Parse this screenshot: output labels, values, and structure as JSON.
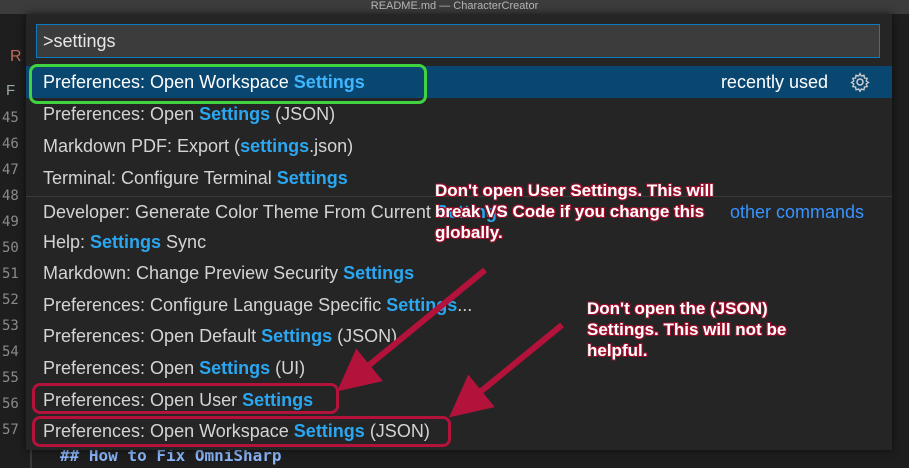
{
  "window": {
    "title": "README.md — CharacterCreator"
  },
  "editor": {
    "tab_fragments": [
      "R",
      "F"
    ],
    "line_numbers": [
      "45",
      "46",
      "47",
      "48",
      "49",
      "50",
      "51",
      "52",
      "53",
      "54",
      "55",
      "56",
      "57"
    ],
    "bottom_text": "## How to Fix OmniSharp"
  },
  "palette": {
    "query": ">settings",
    "items": [
      {
        "pre": "Preferences: Open Workspace ",
        "hl": "Settings",
        "post": "",
        "right": "recently used"
      },
      {
        "pre": "Preferences: Open ",
        "hl": "Settings",
        "post": " (JSON)",
        "right": ""
      },
      {
        "pre": "Markdown PDF: Export (",
        "hl": "settings",
        "post": ".json)",
        "right": ""
      },
      {
        "pre": "Terminal: Configure Terminal ",
        "hl": "Settings",
        "post": "",
        "right": ""
      },
      {
        "pre": "Developer: Generate Color Theme From Current ",
        "hl": "Settings",
        "post": "",
        "right": "other commands"
      },
      {
        "pre": "Help: ",
        "hl": "Settings",
        "post": " Sync",
        "right": ""
      },
      {
        "pre": "Markdown: Change Preview Security ",
        "hl": "Settings",
        "post": "",
        "right": ""
      },
      {
        "pre": "Preferences: Configure Language Specific ",
        "hl": "Settings",
        "post": "...",
        "right": ""
      },
      {
        "pre": "Preferences: Open Default ",
        "hl": "Settings",
        "post": " (JSON)",
        "right": ""
      },
      {
        "pre": "Preferences: Open ",
        "hl": "Settings",
        "post": " (UI)",
        "right": ""
      },
      {
        "pre": "Preferences: Open User ",
        "hl": "Settings",
        "post": "",
        "right": ""
      },
      {
        "pre": "Preferences: Open Workspace ",
        "hl": "Settings",
        "post": " (JSON)",
        "right": ""
      }
    ]
  },
  "annotations": {
    "note1": "Don't open User Settings. This will break VS Code if you change this globally.",
    "note2": "Don't open the (JSON) Settings. This will not be helpful."
  },
  "colors": {
    "good_box": "#3fd33f",
    "bad_box": "#b3123a",
    "accent": "#094771",
    "highlight": "#2aa7f0"
  },
  "icons": {
    "configure": "gear-icon"
  }
}
